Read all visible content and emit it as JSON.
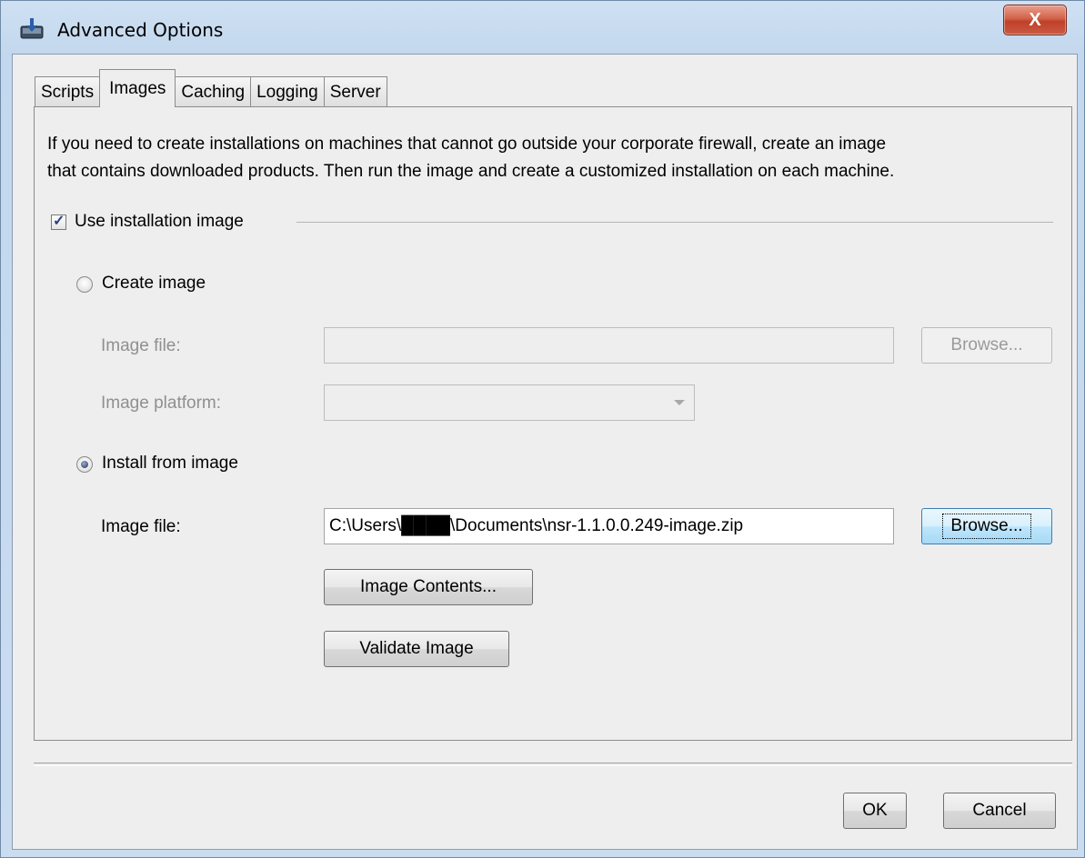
{
  "window": {
    "title": "Advanced Options",
    "close_glyph": "X"
  },
  "tabs": [
    {
      "label": "Scripts"
    },
    {
      "label": "Images"
    },
    {
      "label": "Caching"
    },
    {
      "label": "Logging"
    },
    {
      "label": "Server"
    }
  ],
  "active_tab": "Images",
  "images": {
    "description_line1": "If you need to create installations on machines that cannot go outside your corporate firewall, create an image",
    "description_line2": "that contains downloaded products. Then run the image and create a customized installation on each machine.",
    "use_image_label": "Use installation image",
    "use_image_checked": true,
    "create_image": {
      "label": "Create image",
      "selected": false,
      "image_file_label": "Image file:",
      "image_file_value": "",
      "browse_label": "Browse...",
      "platform_label": "Image platform:",
      "platform_value": ""
    },
    "install_from_image": {
      "label": "Install from image",
      "selected": true,
      "image_file_label": "Image file:",
      "image_file_value": "C:\\Users\\████\\Documents\\nsr-1.1.0.0.249-image.zip",
      "browse_label": "Browse...",
      "contents_label": "Image Contents...",
      "validate_label": "Validate Image"
    }
  },
  "footer": {
    "ok_label": "OK",
    "cancel_label": "Cancel"
  },
  "icons": {
    "title": "download-installer-icon",
    "check": "checkmark-icon"
  }
}
